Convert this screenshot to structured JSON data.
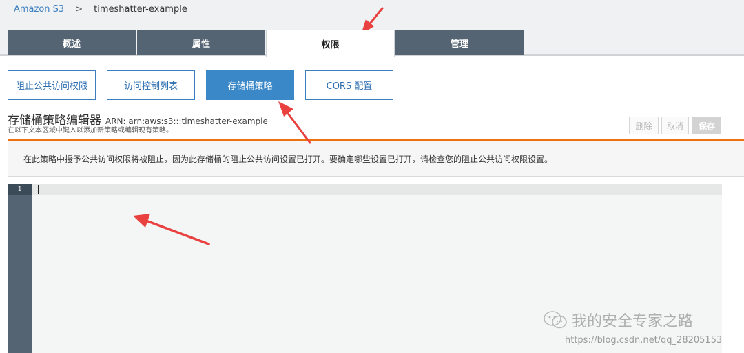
{
  "breadcrumb": {
    "root": "Amazon S3",
    "separator": ">",
    "current": "timeshatter-example"
  },
  "main_tabs": [
    {
      "label": "概述",
      "active": false
    },
    {
      "label": "属性",
      "active": false
    },
    {
      "label": "权限",
      "active": true
    },
    {
      "label": "管理",
      "active": false
    }
  ],
  "sub_tabs": [
    {
      "label": "阻止公共访问权限",
      "active": false
    },
    {
      "label": "访问控制列表",
      "active": false
    },
    {
      "label": "存储桶策略",
      "active": true
    },
    {
      "label": "CORS 配置",
      "active": false
    }
  ],
  "editor_header": {
    "title": "存储桶策略编辑器",
    "arn": "ARN: arn:aws:s3:::timeshatter-example",
    "description": "在以下文本区域中键入以添加新策略或编辑现有策略。"
  },
  "actions": {
    "delete": "删除",
    "cancel": "取消",
    "save": "保存"
  },
  "warning": {
    "text": "在此策略中授予公共访问权限将被阻止，因为此存储桶的阻止公共访问设置已打开。要确定哪些设置已打开，请检查您的阻止公共访问权限设置。"
  },
  "code_editor": {
    "line_numbers": [
      "1"
    ],
    "content": ""
  },
  "watermark": {
    "text": "我的安全专家之路",
    "url": "https://blog.csdn.net/qq_28205153"
  },
  "colors": {
    "tab_inactive": "#546473",
    "tab_active": "#ffffff",
    "sub_tab_active": "#3b88c9",
    "link": "#3b7fc0",
    "warning_accent": "#ec7211",
    "gutter": "#546473",
    "annotation_arrow": "#e8413f"
  }
}
